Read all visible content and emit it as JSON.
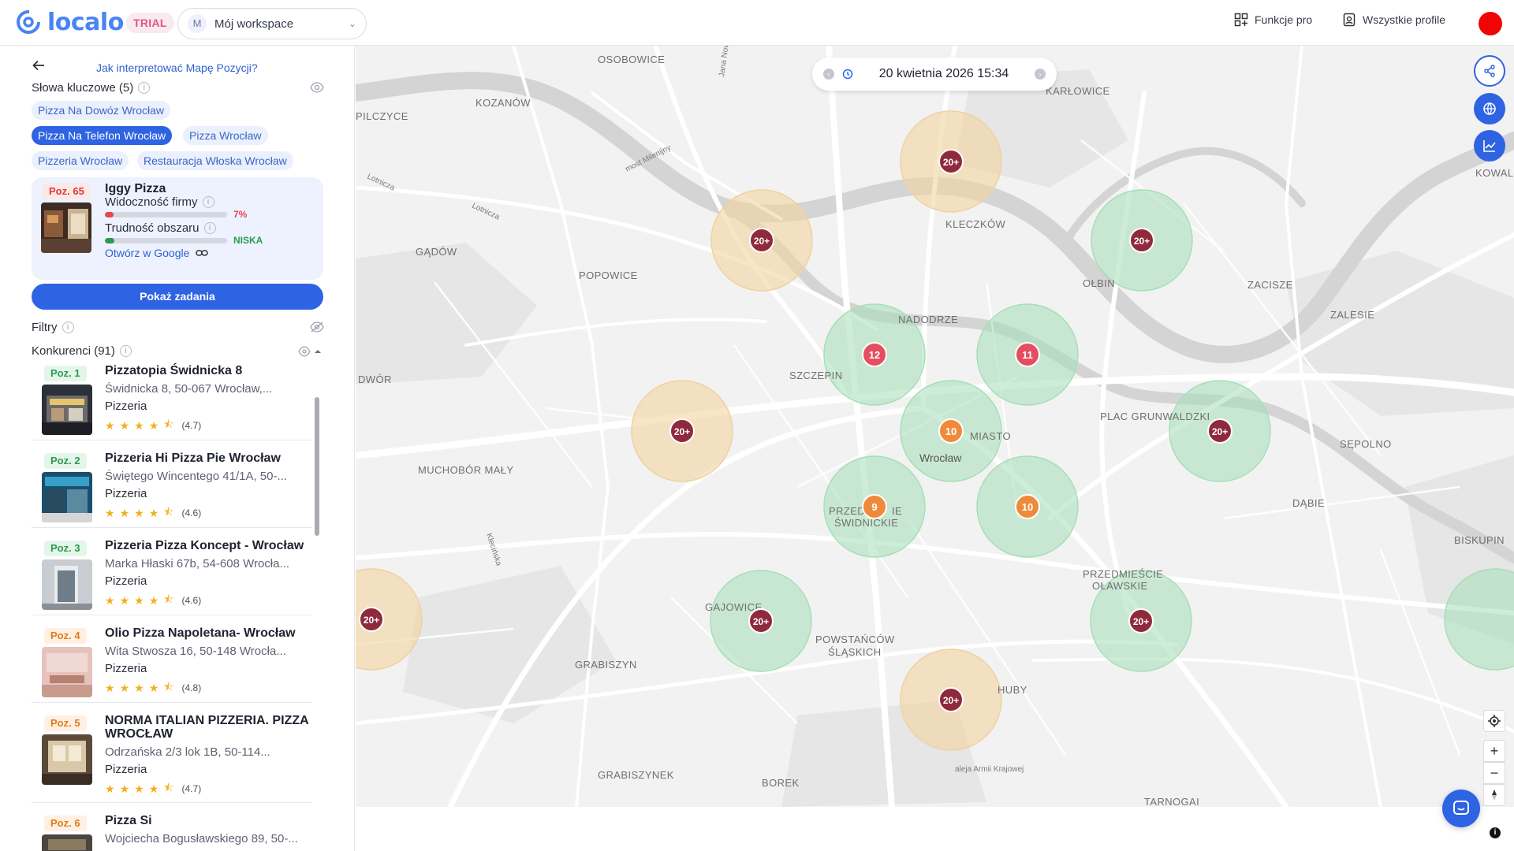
{
  "app": {
    "logo_text": "localo",
    "trial_label": "TRIAL"
  },
  "workspace": {
    "avatar_letter": "M",
    "name": "Mój workspace"
  },
  "top_actions": {
    "pro_features": "Funkcje pro",
    "all_profiles": "Wszystkie profile"
  },
  "sidebar": {
    "help_link": "Jak interpretować Mapę Pozycji?",
    "keywords_label": "Słowa kluczowe (5)",
    "keywords": [
      {
        "label": "Pizza Na Dowóz Wrocław",
        "active": false
      },
      {
        "label": "Pizza Na Telefon Wrocław",
        "active": true
      },
      {
        "label": "Pizza Wrocław",
        "active": false
      },
      {
        "label": "Pizzeria Wrocław",
        "active": false
      },
      {
        "label": "Restauracja Włoska Wrocław",
        "active": false
      }
    ],
    "business": {
      "position": "Poz. 65",
      "name": "Iggy Pizza",
      "visibility_label": "Widoczność firmy",
      "visibility_value": "7%",
      "visibility_fraction": 0.07,
      "difficulty_label": "Trudność obszaru",
      "difficulty_value": "NISKA",
      "difficulty_fraction": 0.08,
      "open_google": "Otwórz w Google"
    },
    "tasks_button": "Pokaż zadania",
    "filters_label": "Filtry",
    "competitors_label": "Konkurenci (91)",
    "competitors": [
      {
        "pos": "Poz. 1",
        "name": "Pizzatopia Świdnicka 8",
        "address": "Świdnicka 8, 50-067 Wrocław,...",
        "category": "Pizzeria",
        "rating": "(4.7)"
      },
      {
        "pos": "Poz. 2",
        "name": "Pizzeria Hi Pizza Pie Wrocław",
        "address": "Świętego Wincentego 41/1A, 50-...",
        "category": "Pizzeria",
        "rating": "(4.6)"
      },
      {
        "pos": "Poz. 3",
        "name": "Pizzeria Pizza Koncept - Wrocław",
        "address": "Marka Hłaski 67b, 54-608 Wrocła...",
        "category": "Pizzeria",
        "rating": "(4.6)"
      },
      {
        "pos": "Poz. 4",
        "name": "Olio Pizza Napoletana- Wrocław",
        "address": "Wita Stwosza 16, 50-148 Wrocła...",
        "category": "Pizzeria",
        "rating": "(4.8)"
      },
      {
        "pos": "Poz. 5",
        "name": "NORMA ITALIAN PIZZERIA. PIZZA WROCŁAW",
        "address": "Odrzańska 2/3 lok 1B, 50-114...",
        "category": "Pizzeria",
        "rating": "(4.7)"
      },
      {
        "pos": "Poz. 6",
        "name": "Pizza Si",
        "address": "Wojciecha Bogusławskiego 89, 50-...",
        "category": "",
        "rating": ""
      }
    ]
  },
  "map": {
    "datetime": "20 kwietnia 2026 15:34",
    "districts": [
      "OSOBOWICE",
      "KOZANÓW",
      "PILCZYCE",
      "KARŁOWICE",
      "KLECZKÓW",
      "GĄDÓW",
      "POPOWICE",
      "OŁBIN",
      "ZACISZE",
      "ZALESIE",
      "NADODRZE",
      "SZCZEPIN",
      "DWÓR",
      "MUCHOBÓR MAŁY",
      "MIASTO",
      "Wrocław",
      "PLAC GRUNWALDZKI",
      "SĘPOLNO",
      "DĄBIE",
      "PRZED",
      "IE",
      "ŚWIDNICKIE",
      "BISKUPIN",
      "PRZEDMIEŚCIE",
      "OŁAWSKIE",
      "GAJOWICE",
      "POWSTAŃCÓW",
      "ŚLĄSKICH",
      "GRABISZYN",
      "HUBY",
      "GRABISZYNEK",
      "BOREK",
      "TARNOGAI",
      "KOWALE"
    ],
    "streets": [
      "Jana Nowaka",
      "most Milenijny",
      "Lotnicza",
      "Lotnicza",
      "Klecińska",
      "aleja Armii Krajowej"
    ],
    "pins": [
      {
        "label": "20+",
        "zone": "orange"
      },
      {
        "label": "20+",
        "zone": "orange"
      },
      {
        "label": "20+",
        "zone": "green"
      },
      {
        "label": "12",
        "zone": "green"
      },
      {
        "label": "11",
        "zone": "green"
      },
      {
        "label": "20+",
        "zone": "orange"
      },
      {
        "label": "10",
        "zone": "green"
      },
      {
        "label": "20+",
        "zone": "green"
      },
      {
        "label": "9",
        "zone": "green"
      },
      {
        "label": "10",
        "zone": "green"
      },
      {
        "label": "20+",
        "zone": "orange"
      },
      {
        "label": "20+",
        "zone": "green"
      },
      {
        "label": "20+",
        "zone": "green"
      },
      {
        "label": "20+",
        "zone": "orange"
      }
    ],
    "attribution": "i"
  },
  "colors": {
    "accent": "#2e63e3",
    "pin_dark": "#8e2a3c",
    "pin_red": "#e54e61",
    "pin_orange": "#f08a3b",
    "zone_green": "#a6dfb8",
    "zone_orange": "#f2d4a0"
  }
}
